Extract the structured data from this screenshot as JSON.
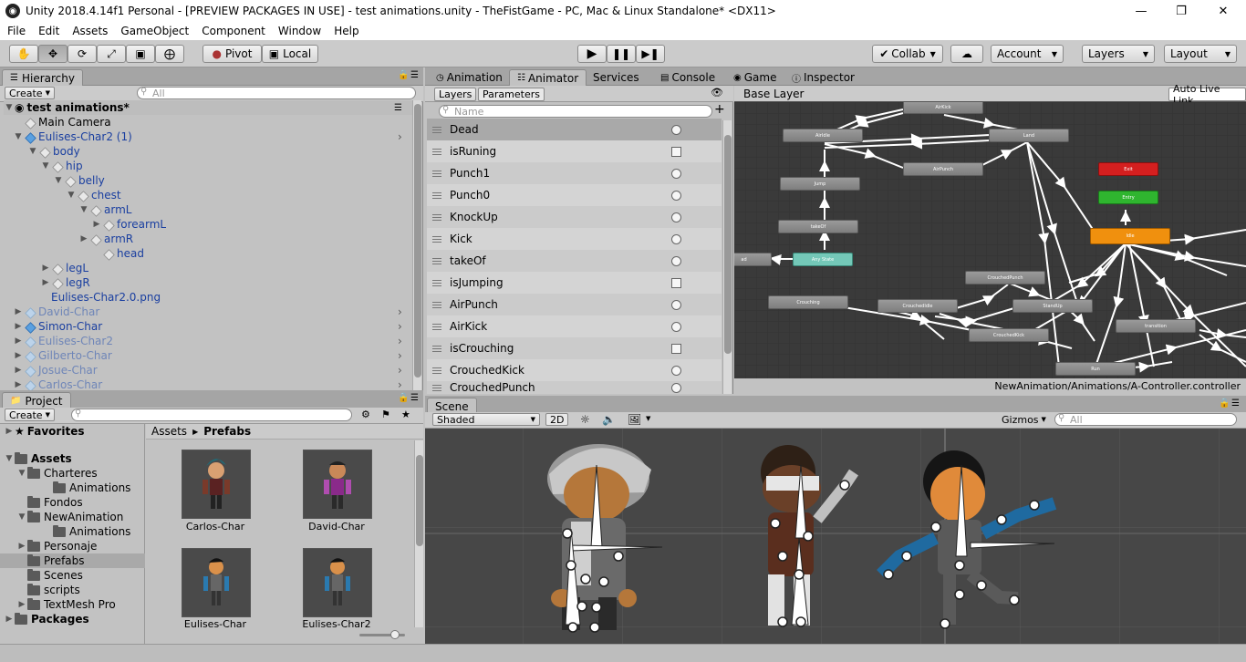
{
  "window": {
    "title": "Unity 2018.4.14f1 Personal - [PREVIEW PACKAGES IN USE] - test animations.unity - TheFistGame - PC, Mac & Linux Standalone* <DX11>",
    "minimize": "—",
    "maximize": "❐",
    "close": "✕"
  },
  "menu": [
    "File",
    "Edit",
    "Assets",
    "GameObject",
    "Component",
    "Window",
    "Help"
  ],
  "toolbar": {
    "pivot": "Pivot",
    "local": "Local",
    "collab": "Collab",
    "account": "Account",
    "layers": "Layers",
    "layout": "Layout"
  },
  "hierarchy": {
    "tab": "Hierarchy",
    "create": "Create",
    "search_placeholder": "All",
    "scene": "test animations*",
    "items": [
      {
        "label": "Main Camera",
        "color": "#000000"
      },
      {
        "label": "Eulises-Char2 (1)",
        "color": "#1a3fa0"
      },
      {
        "label": "body",
        "color": "#1a3fa0"
      },
      {
        "label": "hip",
        "color": "#1a3fa0"
      },
      {
        "label": "belly",
        "color": "#1a3fa0"
      },
      {
        "label": "chest",
        "color": "#1a3fa0"
      },
      {
        "label": "armL",
        "color": "#1a3fa0"
      },
      {
        "label": "forearmL",
        "color": "#1a3fa0"
      },
      {
        "label": "armR",
        "color": "#1a3fa0"
      },
      {
        "label": "head",
        "color": "#1a3fa0"
      },
      {
        "label": "legL",
        "color": "#1a3fa0"
      },
      {
        "label": "legR",
        "color": "#1a3fa0"
      },
      {
        "label": "Eulises-Char2.0.png",
        "color": "#1a3fa0"
      },
      {
        "label": "David-Char",
        "color": "#6f86b8"
      },
      {
        "label": "Simon-Char",
        "color": "#1a3fa0"
      },
      {
        "label": "Eulises-Char2",
        "color": "#6f86b8"
      },
      {
        "label": "Gilberto-Char",
        "color": "#6f86b8"
      },
      {
        "label": "Josue-Char",
        "color": "#6f86b8"
      },
      {
        "label": "Carlos-Char",
        "color": "#6f86b8"
      }
    ]
  },
  "project": {
    "tab": "Project",
    "create": "Create",
    "favorites": "Favorites",
    "assets": "Assets",
    "tree": [
      "Charteres",
      "Animations",
      "Fondos",
      "NewAnimation",
      "Animations",
      "Personaje",
      "Prefabs",
      "Scenes",
      "scripts",
      "TextMesh Pro"
    ],
    "packages": "Packages",
    "breadcrumb_root": "Assets",
    "breadcrumb_sep": "▶",
    "breadcrumb_current": "Prefabs",
    "prefabs": [
      "Carlos-Char",
      "David-Char",
      "Eulises-Char",
      "Eulises-Char2"
    ]
  },
  "tabs_top": [
    "Animation",
    "Animator",
    "Services",
    "Console",
    "Game",
    "Inspector"
  ],
  "animator": {
    "layers_tab": "Layers",
    "parameters_tab": "Parameters",
    "search_placeholder": "Name",
    "add": "+",
    "base_layer": "Base Layer",
    "auto_live_link": "Auto Live Link",
    "controller_path": "NewAnimation/Animations/A-Controller.controller",
    "parameters": [
      {
        "name": "Dead",
        "type": "trigger"
      },
      {
        "name": "isRuning",
        "type": "bool"
      },
      {
        "name": "Punch1",
        "type": "trigger"
      },
      {
        "name": "Punch0",
        "type": "trigger"
      },
      {
        "name": "KnockUp",
        "type": "trigger"
      },
      {
        "name": "Kick",
        "type": "trigger"
      },
      {
        "name": "takeOf",
        "type": "trigger"
      },
      {
        "name": "isJumping",
        "type": "bool"
      },
      {
        "name": "AirPunch",
        "type": "trigger"
      },
      {
        "name": "AirKick",
        "type": "trigger"
      },
      {
        "name": "isCrouching",
        "type": "bool"
      },
      {
        "name": "CrouchedKick",
        "type": "trigger"
      },
      {
        "name": "CrouchedPunch",
        "type": "trigger"
      }
    ],
    "states": {
      "airkick": "AirKick",
      "airidle": "AirIdle",
      "land": "Land",
      "airpunch": "AirPunch",
      "exit": "Exit",
      "entry": "Entry",
      "jump": "Jump",
      "takeof": "takeOf",
      "idle": "Idle",
      "anystate": "Any State",
      "dead": "ad",
      "crouchedpunch": "CrouchedPunch",
      "crouching": "Crouching",
      "crouchedidle": "CrouchedIdle",
      "standup": "StandUp",
      "transition": "transition",
      "crouchedkick": "CrouchedKick",
      "run": "Run"
    },
    "colors": {
      "exit": "#d41f1f",
      "entry": "#2fb52f",
      "idle": "#f0900e",
      "anystate": "#74c8b8",
      "graph_bg": "#3a3a3a"
    }
  },
  "scene": {
    "tab": "Scene",
    "shading": "Shaded",
    "mode_2d": "2D",
    "gizmos": "Gizmos",
    "search_placeholder": "All"
  }
}
